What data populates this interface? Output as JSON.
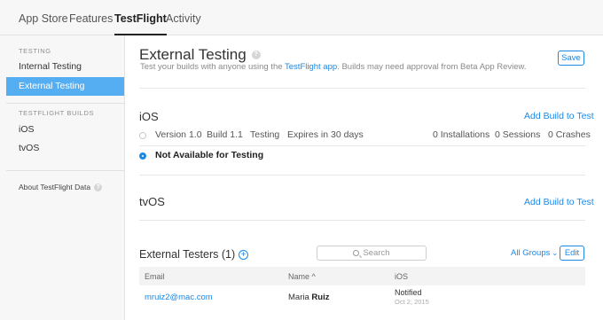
{
  "topnav": {
    "tabs": [
      {
        "label": "App Store"
      },
      {
        "label": "Features"
      },
      {
        "label": "TestFlight"
      },
      {
        "label": "Activity"
      }
    ],
    "active": "TestFlight"
  },
  "sidebar": {
    "testing_heading": "TESTING",
    "testing_items": [
      {
        "label": "Internal Testing"
      },
      {
        "label": "External Testing"
      }
    ],
    "builds_heading": "TESTFLIGHT BUILDS",
    "build_items": [
      {
        "label": "iOS"
      },
      {
        "label": "tvOS"
      }
    ],
    "about_label": "About TestFlight Data",
    "help_glyph": "?"
  },
  "header": {
    "title": "External Testing",
    "help_glyph": "?",
    "subtitle_pre": "Test your builds with anyone using the ",
    "subtitle_link": "TestFlight app",
    "subtitle_post": ". Builds may need approval from Beta App Review.",
    "save_label": "Save"
  },
  "ios_section": {
    "title": "iOS",
    "add_label": "Add Build to Test",
    "build_row": {
      "version": "Version 1.0",
      "build": "Build 1.1",
      "status": "Testing",
      "expires": "Expires in 30 days",
      "installations": "0 Installations",
      "sessions": "0 Sessions",
      "crashes": "0 Crashes"
    },
    "not_available_label": "Not Available for Testing"
  },
  "tvos_section": {
    "title": "tvOS",
    "add_label": "Add Build to Test"
  },
  "testers": {
    "title": "External Testers (1)",
    "search_placeholder": "Search",
    "groups_label": "All Groups",
    "edit_label": "Edit",
    "columns": {
      "email": "Email",
      "name": "Name ^",
      "ios": "iOS"
    },
    "rows": [
      {
        "email": "mruiz2@mac.com",
        "first_name": "Maria",
        "last_name": "Ruiz",
        "status": "Notified",
        "date": "Oct 2, 2015"
      }
    ]
  },
  "colors": {
    "accent": "#1e88e5",
    "sidebar_active": "#55aef2"
  }
}
